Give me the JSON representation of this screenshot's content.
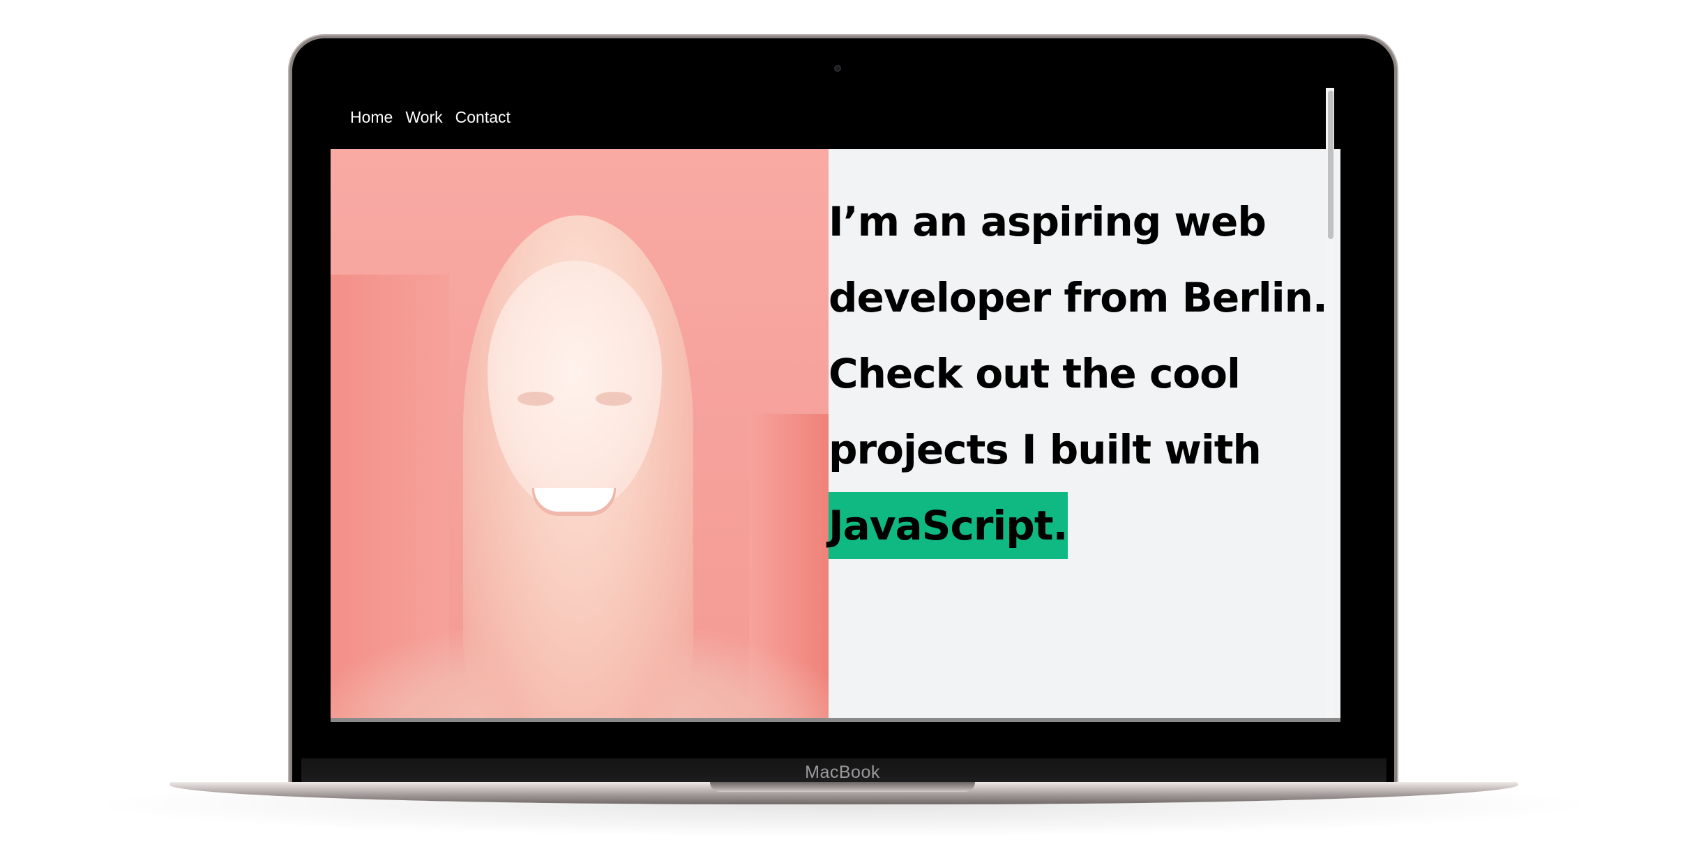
{
  "device": {
    "brand_label": "MacBook"
  },
  "navbar": {
    "links": [
      {
        "label": "Home"
      },
      {
        "label": "Work"
      },
      {
        "label": "Contact"
      }
    ]
  },
  "hero": {
    "photo_icon": "portrait-photo",
    "headline_main": "I’m an aspiring web developer from Berlin. Check out the cool projects I built with ",
    "headline_highlight": "JavaScript."
  },
  "colors": {
    "accent": "#10b981",
    "photo_tint": "#f8aaa3",
    "panel_bg": "#f2f3f5",
    "nav_bg": "#000000"
  }
}
